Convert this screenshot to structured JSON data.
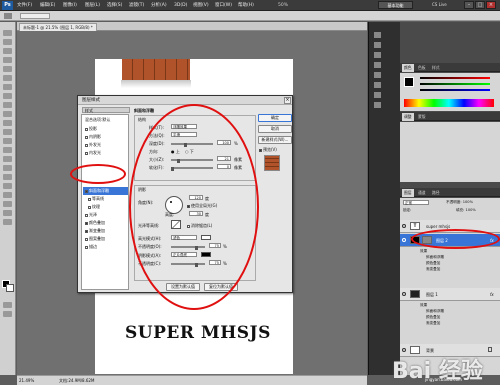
{
  "menubar": {
    "logo": "Ps",
    "items": [
      "文件(F)",
      "编辑(E)",
      "图像(I)",
      "图层(L)",
      "选择(S)",
      "滤镜(T)",
      "分析(A)",
      "3D(D)",
      "视图(V)",
      "窗口(W)",
      "帮助(H)"
    ],
    "zoom": "50%",
    "workspace": "基本功能",
    "cs_live": "CS Live",
    "win_min": "–",
    "win_max": "□",
    "win_close": "×"
  },
  "document": {
    "tab": "未标题-1 @ 21.5% (图层 1, RGB/8) *",
    "text": "SUPER MHSJS"
  },
  "status": {
    "zoom": "21.49%",
    "info": "文档:24.9M/8.62M"
  },
  "dialog": {
    "title": "图层样式",
    "close": "×",
    "styles_header": "样式",
    "blend_options": "混合选项:默认",
    "styles": [
      {
        "label": "投影",
        "checked": false
      },
      {
        "label": "内阴影",
        "checked": false
      },
      {
        "label": "外发光",
        "checked": false
      },
      {
        "label": "内发光",
        "checked": false
      },
      {
        "label": "斜面和浮雕",
        "checked": true,
        "selected": true
      },
      {
        "label": "等高线",
        "checked": false
      },
      {
        "label": "纹理",
        "checked": false
      },
      {
        "label": "光泽",
        "checked": false
      },
      {
        "label": "颜色叠加",
        "checked": true
      },
      {
        "label": "渐变叠加",
        "checked": true
      },
      {
        "label": "图案叠加",
        "checked": false
      },
      {
        "label": "描边",
        "checked": false
      }
    ],
    "section_title": "斜面和浮雕",
    "structure": {
      "title": "结构",
      "style_label": "样式(T):",
      "style_value": "浮雕效果",
      "method_label": "方法(Q):",
      "method_value": "平滑",
      "depth_label": "深度(D):",
      "depth_value": "100",
      "depth_level": 0.33,
      "direction_label": "方向:",
      "direction_up": "上",
      "direction_down": "下",
      "size_label": "大小(Z):",
      "size_value": "21",
      "size_level": 0.16,
      "soften_label": "软化(F):",
      "soften_value": "0",
      "soften_level": 0.0,
      "unit_pct": "%",
      "unit_px": "像素"
    },
    "shading": {
      "title": "阴影",
      "angle_label": "角度(N):",
      "angle_value": "120",
      "angle_unit": "度",
      "global_light": "使用全局光(G)",
      "altitude_label": "高度:",
      "altitude_value": "30",
      "altitude_unit": "度",
      "gloss_label": "光泽等高线:",
      "anti_alias": "消除锯齿(L)",
      "highlight_label": "高光模式(H):",
      "highlight_value": "滤色",
      "opacity1_label": "不透明度(O):",
      "opacity1_value": "75",
      "opacity1_level": 0.75,
      "shadow_label": "阴影模式(A):",
      "shadow_value": "正片叠底",
      "opacity2_label": "不透明度(C):",
      "opacity2_value": "75",
      "opacity2_level": 0.75,
      "unit_pct": "%"
    },
    "make_default": "设置为默认值",
    "reset_default": "复位为默认值",
    "ok": "确定",
    "cancel": "取消",
    "new_style": "新建样式(W)...",
    "preview": "预览(V)"
  },
  "panels": {
    "tabs1": [
      "颜色",
      "色板",
      "样式"
    ],
    "tabs2": [
      "调整",
      "蒙版"
    ],
    "tabs3": [
      "图层",
      "通道",
      "路径"
    ],
    "blend_mode": "正常",
    "opacity": "不透明度: 100%",
    "lock": "锁定:",
    "fill": "填充: 100%",
    "layers": [
      {
        "name": "super mhsjs",
        "type": "text",
        "selected": false
      },
      {
        "name": "图层 2",
        "type": "image",
        "selected": true,
        "fx": true,
        "effects": [
          "效果",
          "斜面和浮雕",
          "颜色叠加",
          "渐变叠加"
        ]
      },
      {
        "name": "图层 1",
        "type": "image",
        "selected": false,
        "fx": true,
        "effects": [
          "效果",
          "斜面和浮雕",
          "颜色叠加",
          "渐变叠加"
        ]
      },
      {
        "name": "背景",
        "type": "bg",
        "selected": false
      }
    ]
  },
  "watermark": {
    "text": "Bai 经验",
    "sub": "jingyan.baidu.com"
  },
  "colors": {
    "highlight": "#e01010",
    "selection": "#3875d7",
    "brick": "#b0522a"
  }
}
